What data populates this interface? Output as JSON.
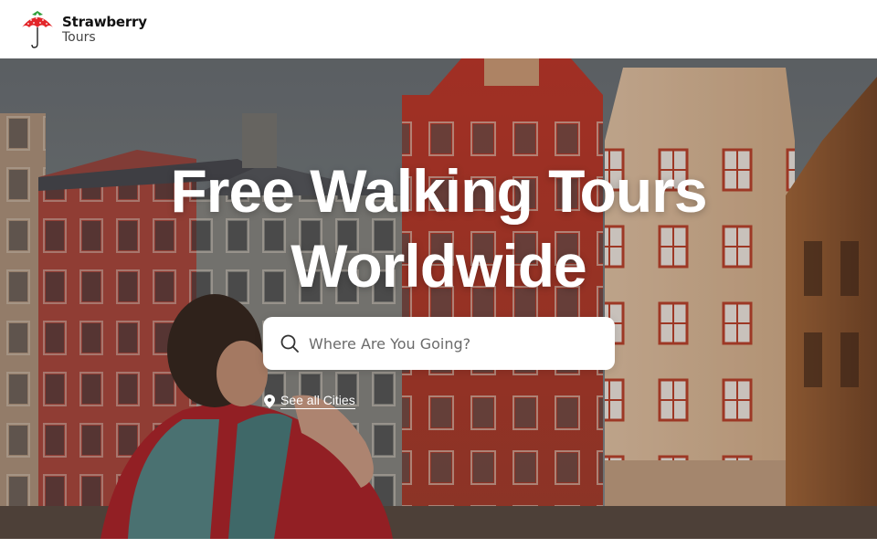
{
  "header": {
    "brand_name": "Strawberry",
    "brand_sub": "Tours",
    "logo_icon": "strawberry-umbrella-icon"
  },
  "hero": {
    "title_line1": "Free Walking Tours",
    "title_line2": "Worldwide",
    "search": {
      "placeholder": "Where Are You Going?",
      "value": "",
      "icon": "search-icon"
    },
    "cities_link": {
      "label": "See all Cities",
      "icon": "location-pin-icon"
    }
  },
  "colors": {
    "brand_red": "#e3262a",
    "text_dark": "#111111",
    "white": "#ffffff"
  }
}
